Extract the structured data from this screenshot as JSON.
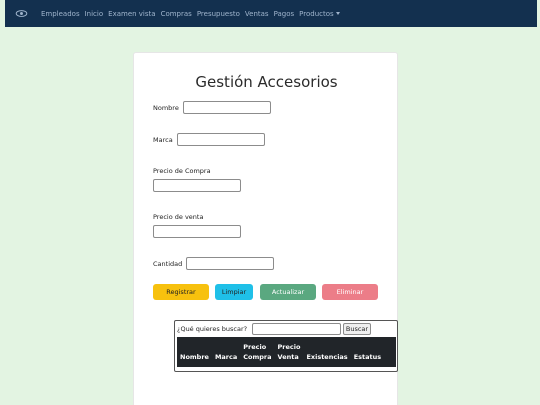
{
  "navbar": {
    "brand_icon": "eye-icon",
    "links": [
      "Empleados",
      "Inicio",
      "Examen vista",
      "Compras",
      "Presupuesto",
      "Ventas",
      "Pagos"
    ],
    "dropdown": "Productos"
  },
  "form": {
    "title": "Gestión Accesorios",
    "nombre_label": "Nombre",
    "marca_label": "Marca",
    "precio_compra_label": "Precio de Compra",
    "precio_venta_label": "Precio de venta",
    "cantidad_label": "Cantidad"
  },
  "buttons": {
    "registrar": "Registrar",
    "limpiar": "Limpiar",
    "actualizar": "Actualizar",
    "eliminar": "Eliminar"
  },
  "search": {
    "label": "¿Qué quieres buscar?",
    "button": "Buscar"
  },
  "table": {
    "headers": [
      {
        "line1": "Nombre",
        "line2": ""
      },
      {
        "line1": "Marca",
        "line2": ""
      },
      {
        "line1": "Precio",
        "line2": "Compra"
      },
      {
        "line1": "Precio",
        "line2": "Venta"
      },
      {
        "line1": "Existencias",
        "line2": ""
      },
      {
        "line1": "Estatus",
        "line2": ""
      }
    ]
  },
  "colors": {
    "navbar": "#13304f",
    "page_bg": "#e3f4e2",
    "registrar": "#f7c10e",
    "limpiar": "#1fc0e8",
    "actualizar": "#5aa880",
    "eliminar": "#ec7d88",
    "table_head": "#212529"
  }
}
